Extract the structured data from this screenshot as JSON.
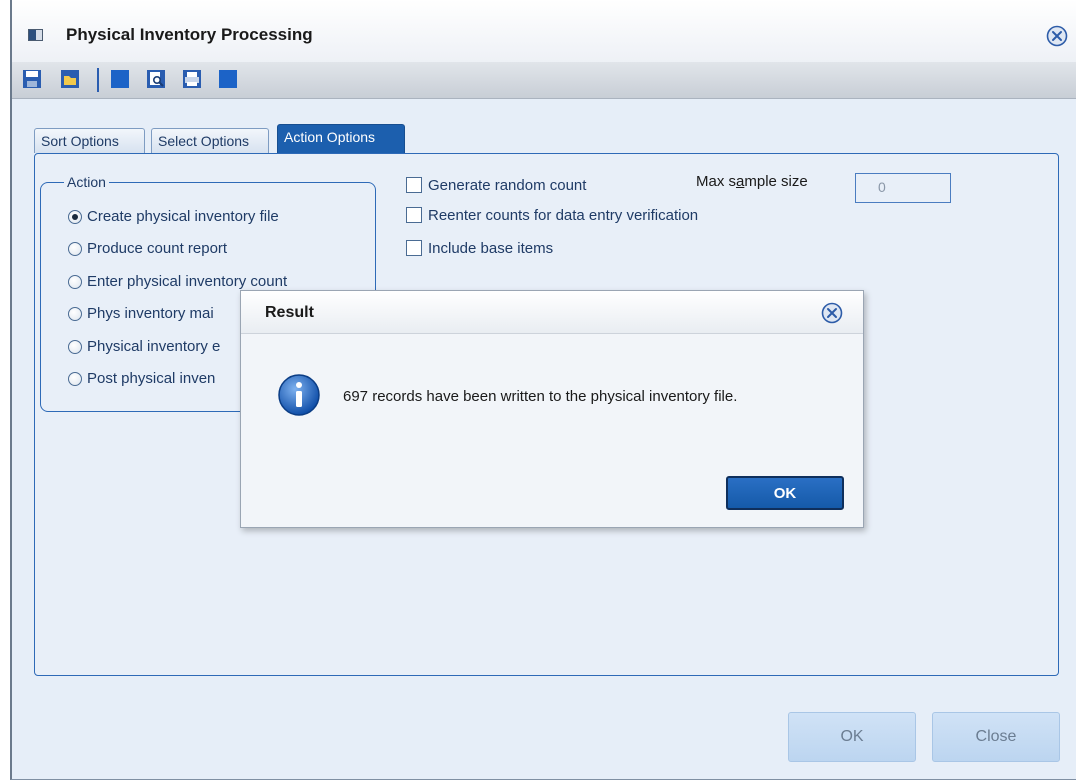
{
  "window": {
    "title": "Physical Inventory Processing",
    "close_icon": "close-circle-icon"
  },
  "toolbar": {
    "icons": [
      "save-icon",
      "open-folder-icon",
      "blank-blue-icon",
      "print-preview-icon",
      "print-icon",
      "blank-blue-icon"
    ]
  },
  "tabs": [
    {
      "label": "Sort Options",
      "active": false
    },
    {
      "label": "Select Options",
      "active": false
    },
    {
      "label": "Action Options",
      "active": true
    }
  ],
  "action_group": {
    "legend": "Action",
    "options": [
      {
        "label": "Create physical inventory file",
        "checked": true
      },
      {
        "label": "Produce count report",
        "checked": false
      },
      {
        "label": "Enter physical inventory count",
        "checked": false
      },
      {
        "label": "Phys inventory mai",
        "checked": false
      },
      {
        "label": "Physical inventory e",
        "checked": false
      },
      {
        "label": "Post physical inven",
        "checked": false
      }
    ]
  },
  "checkboxes": [
    {
      "label": "Generate random count",
      "checked": false
    },
    {
      "label": "Reenter counts for data entry verification",
      "checked": false
    },
    {
      "label": "Include base items",
      "checked": false
    }
  ],
  "max_sample": {
    "label_pre": "Max s",
    "label_underlined": "a",
    "label_post": "mple size",
    "value": "0"
  },
  "buttons": {
    "ok": "OK",
    "close": "Close"
  },
  "dialog": {
    "title": "Result",
    "message": "697 records have been written to the physical inventory file.",
    "ok": "OK",
    "icon": "info-icon"
  },
  "colors": {
    "accent": "#1c5fae",
    "panel_bg": "#e8eff8",
    "text": "#1f3b66"
  }
}
